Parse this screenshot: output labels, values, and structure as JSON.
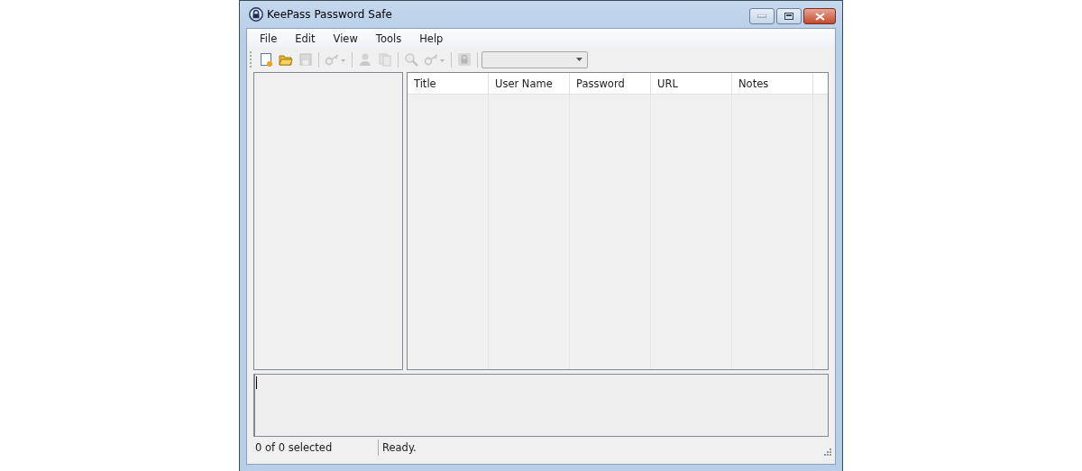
{
  "window": {
    "title": "KeePass Password Safe"
  },
  "menu": [
    "File",
    "Edit",
    "View",
    "Tools",
    "Help"
  ],
  "toolbar": [
    {
      "kind": "new",
      "disabled": false
    },
    {
      "kind": "open",
      "disabled": false
    },
    {
      "kind": "save",
      "disabled": true
    },
    {
      "kind": "separator"
    },
    {
      "kind": "add-entry",
      "disabled": true
    },
    {
      "kind": "separator"
    },
    {
      "kind": "person",
      "disabled": true
    },
    {
      "kind": "copy",
      "disabled": true
    },
    {
      "kind": "separator"
    },
    {
      "kind": "search",
      "disabled": true
    },
    {
      "kind": "key-menu",
      "disabled": true
    },
    {
      "kind": "separator"
    },
    {
      "kind": "lock",
      "disabled": true
    },
    {
      "kind": "separator"
    },
    {
      "kind": "combo",
      "disabled": true
    }
  ],
  "table": {
    "columns": [
      "Title",
      "User Name",
      "Password",
      "URL",
      "Notes"
    ]
  },
  "status_bar": [
    "0 of 0 selected",
    "Ready."
  ]
}
